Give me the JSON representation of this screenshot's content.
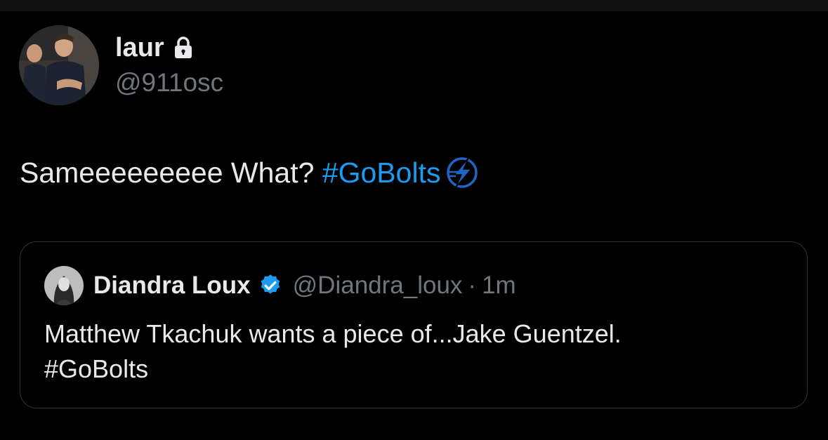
{
  "tweet": {
    "author": {
      "display_name": "laur",
      "handle": "@911osc",
      "protected_icon": "lock-icon",
      "avatar": "profile-photo-two-firefighters"
    },
    "text": {
      "plain": "Sameeeeeeeee What? ",
      "hashtag": "#GoBolts",
      "emoji_icon": "lightning-bolt-logo-icon"
    },
    "quoted_tweet": {
      "author": {
        "display_name": "Diandra Loux",
        "verified_icon": "verified-badge-icon",
        "handle": "@Diandra_loux",
        "avatar": "profile-photo-woman"
      },
      "separator": "·",
      "time": "1m",
      "body_line1": "Matthew Tkachuk wants a piece of...Jake Guentzel.",
      "body_line2": "#GoBolts"
    }
  },
  "colors": {
    "background": "#000000",
    "text_primary": "#e7e9ea",
    "text_secondary": "#71767b",
    "accent": "#1d9bf0",
    "border": "#2f3336",
    "bolt_blue": "#1f66c4"
  }
}
